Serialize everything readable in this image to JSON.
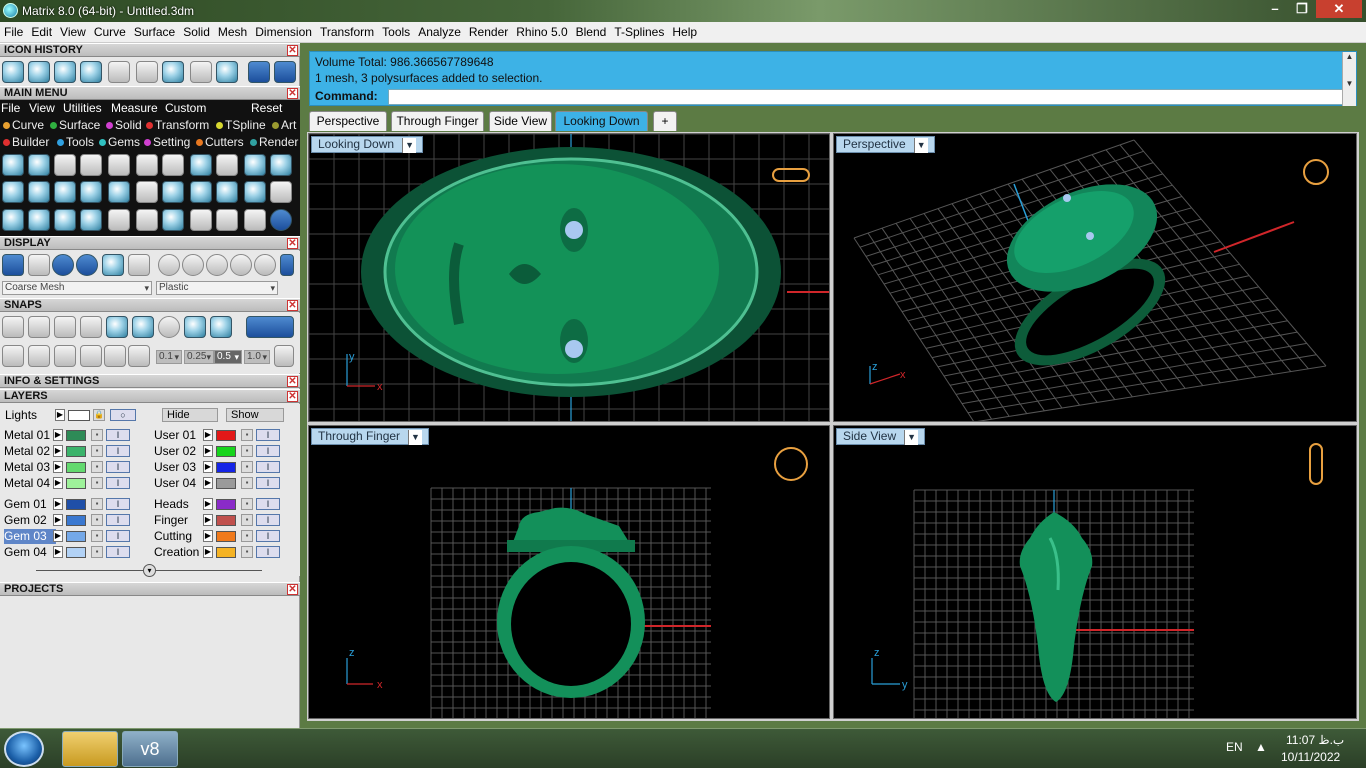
{
  "window": {
    "title": "Matrix 8.0 (64-bit) - Untitled.3dm",
    "btn_min": "–",
    "btn_max": "❐",
    "btn_close": "✕"
  },
  "menu": [
    "File",
    "Edit",
    "View",
    "Curve",
    "Surface",
    "Solid",
    "Mesh",
    "Dimension",
    "Transform",
    "Tools",
    "Analyze",
    "Render",
    "Rhino 5.0",
    "Blend",
    "T-Splines",
    "Help"
  ],
  "panel": {
    "icon_history": "ICON HISTORY",
    "main_menu": "MAIN MENU",
    "main_menu_items": [
      "File",
      "View",
      "Utilities",
      "Measure",
      "Custom",
      "Reset"
    ],
    "categories_row1": [
      "Curve",
      "Surface",
      "Solid",
      "Transform",
      "TSpline",
      "Art"
    ],
    "categories_row2": [
      "Builder",
      "Tools",
      "Gems",
      "Setting",
      "Cutters",
      "Render"
    ],
    "display": "DISPLAY",
    "display_mesh": "Coarse Mesh",
    "display_material": "Plastic",
    "snaps": "SNAPS",
    "snap_values": [
      "0.1",
      "0.25",
      "0.5",
      "1.0"
    ],
    "info_settings": "INFO & SETTINGS",
    "layers": "LAYERS",
    "lights": "Lights",
    "hide": "Hide",
    "show": "Show",
    "layers_left": [
      "Metal 01",
      "Metal 02",
      "Metal 03",
      "Metal 04",
      "Gem 01",
      "Gem 02",
      "Gem 03",
      "Gem 04"
    ],
    "layers_right": [
      "User 01",
      "User 02",
      "User 03",
      "User 04",
      "Heads",
      "Finger",
      "Cutting",
      "Creation"
    ],
    "colors_left": [
      "#2e8b57",
      "#3bb36b",
      "#63d96f",
      "#9ef29a",
      "#1f4fa8",
      "#3a78d0",
      "#74a8e8",
      "#b2d2f6"
    ],
    "colors_right": [
      "#e21818",
      "#16d41c",
      "#1424e6",
      "#9a9a9a",
      "#8a2bc8",
      "#c0504d",
      "#f07a1c",
      "#f5b324"
    ],
    "projects": "PROJECTS"
  },
  "command": {
    "line1": "Volume Total: 986.366567789648",
    "line2": "1 mesh, 3 polysurfaces added to selection.",
    "prompt": "Command:"
  },
  "tabs": [
    "Perspective",
    "Through Finger",
    "Side View",
    "Looking Down",
    "+"
  ],
  "viewports": {
    "tl": "Looking Down",
    "tr": "Perspective",
    "bl": "Through Finger",
    "br": "Side View"
  },
  "axes": {
    "x": "x",
    "y": "y",
    "z": "z"
  },
  "taskbar": {
    "lang": "EN",
    "time": "11:07 ب.ظ",
    "date": "10/11/2022",
    "app_label": "v8"
  },
  "accent": "#3db2e6",
  "model_green": "#1a8a5a"
}
